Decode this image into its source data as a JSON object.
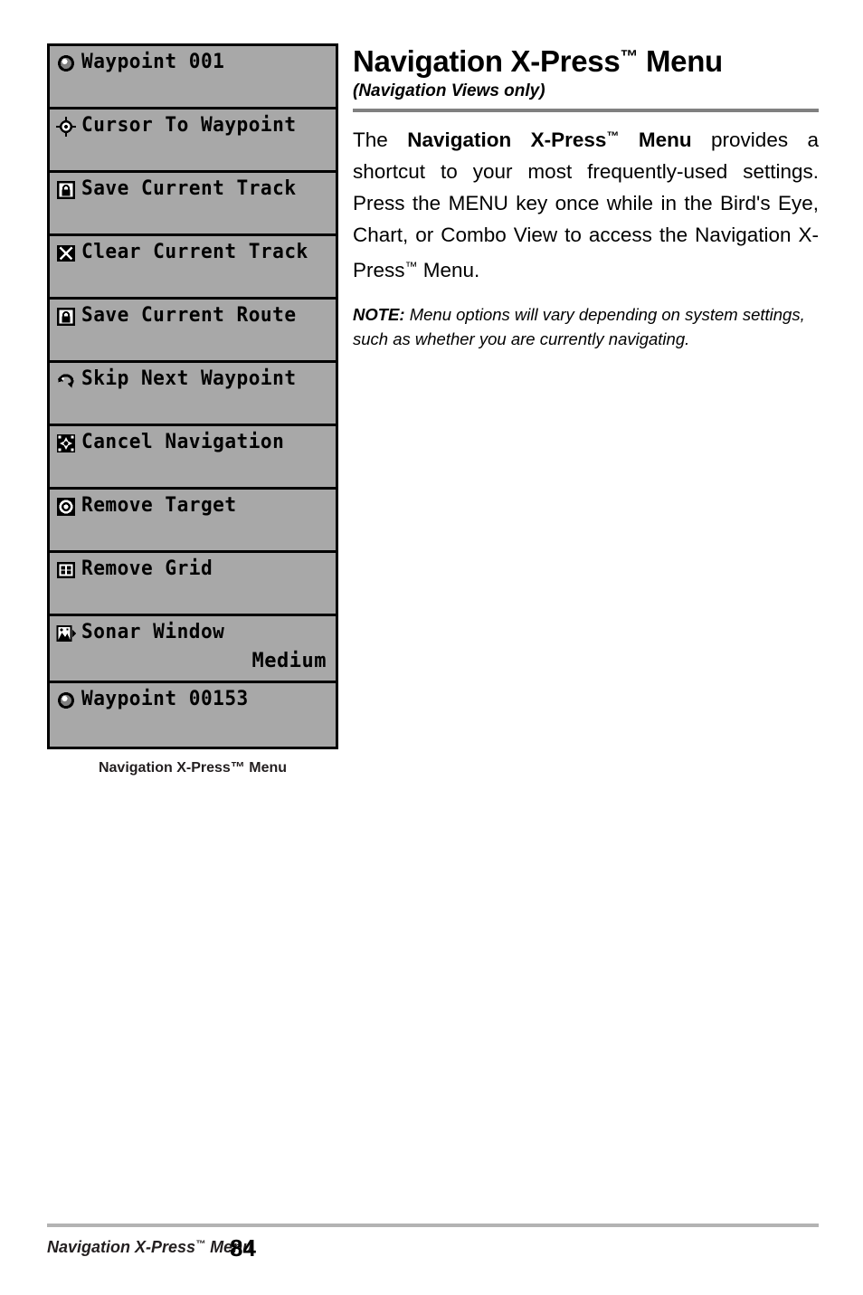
{
  "menu_panel": {
    "rows": [
      {
        "icon": "waypoint-icon",
        "label": "Waypoint 001",
        "value": ""
      },
      {
        "icon": "cursor-target-icon",
        "label": "Cursor To Waypoint",
        "value": ""
      },
      {
        "icon": "save-track-icon",
        "label": "Save Current Track",
        "value": ""
      },
      {
        "icon": "clear-track-icon",
        "label": "Clear Current Track",
        "value": ""
      },
      {
        "icon": "save-route-icon",
        "label": "Save Current Route",
        "value": ""
      },
      {
        "icon": "skip-waypoint-icon",
        "label": "Skip Next Waypoint",
        "value": ""
      },
      {
        "icon": "cancel-navigation-icon",
        "label": "Cancel Navigation",
        "value": ""
      },
      {
        "icon": "remove-target-icon",
        "label": "Remove Target",
        "value": ""
      },
      {
        "icon": "remove-grid-icon",
        "label": "Remove Grid",
        "value": ""
      },
      {
        "icon": "sonar-window-icon",
        "label": "Sonar Window",
        "value": "Medium"
      },
      {
        "icon": "waypoint-icon",
        "label": "Waypoint 00153",
        "value": ""
      }
    ],
    "caption": "Navigation X-Press™ Menu",
    "background_color": "#a8a8a8",
    "border_color": "#000000"
  },
  "content": {
    "heading_main": "Navigation X-Press",
    "heading_tm": "™",
    "heading_tail": " Menu",
    "subheading": "(Navigation Views only)",
    "paragraph": {
      "part1": "The ",
      "bold1": "Navigation X-Press",
      "bold1_tm": "™",
      "bold2": " Menu",
      "part2": " provides a shortcut to your most frequently-used settings. Press the MENU key once while in the Bird's Eye, Chart, or Combo View to access the Navigation X-Press",
      "part2_tm": "™",
      "part3": " Menu."
    },
    "note": {
      "label": "NOTE:",
      "text": " Menu options will vary depending on system settings, such as whether you are currently navigating."
    },
    "rule_color": "#808080"
  },
  "footer": {
    "left_text": "Navigation X-Press",
    "left_tm": "™",
    "left_tail": " Menu",
    "page_number": "84",
    "rule_color": "#b3b3b3"
  }
}
